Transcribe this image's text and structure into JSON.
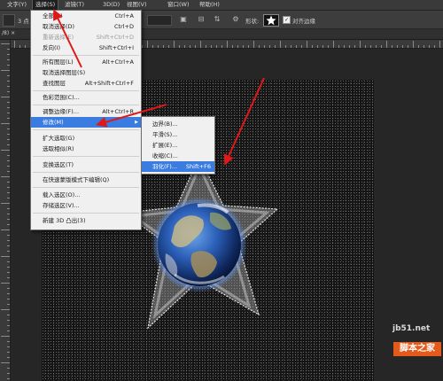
{
  "menubar": {
    "items": [
      "文字(Y)",
      "选择(S)",
      "滤镜(T)",
      "3D(D)",
      "视图(V)",
      "窗口(W)",
      "帮助(H)"
    ]
  },
  "options": {
    "size_value": "3 点",
    "shape_label": "形状:",
    "align_edges_label": "对齐边缘",
    "align_edges_checked": true
  },
  "document_tab": {
    "label": "/8) ×"
  },
  "select_menu": {
    "items": [
      {
        "label": "全部(A)",
        "shortcut": "Ctrl+A",
        "disabled": false
      },
      {
        "label": "取消选择(D)",
        "shortcut": "Ctrl+D",
        "disabled": false
      },
      {
        "label": "重新选择(E)",
        "shortcut": "Shift+Ctrl+D",
        "disabled": true
      },
      {
        "label": "反向(I)",
        "shortcut": "Shift+Ctrl+I",
        "disabled": false
      },
      {
        "label": "所有图层(L)",
        "shortcut": "Alt+Ctrl+A",
        "disabled": false
      },
      {
        "label": "取消选择图层(S)",
        "shortcut": "",
        "disabled": false
      },
      {
        "label": "查找图层",
        "shortcut": "Alt+Shift+Ctrl+F",
        "disabled": false
      },
      {
        "label": "色彩范围(C)...",
        "shortcut": "",
        "disabled": false
      },
      {
        "label": "调整边缘(F)...",
        "shortcut": "Alt+Ctrl+R",
        "disabled": false
      },
      {
        "label": "修改(M)",
        "shortcut": "",
        "disabled": false,
        "highlighted": true,
        "has_submenu": true
      },
      {
        "label": "扩大选取(G)",
        "shortcut": "",
        "disabled": false
      },
      {
        "label": "选取相似(R)",
        "shortcut": "",
        "disabled": false
      },
      {
        "label": "变换选区(T)",
        "shortcut": "",
        "disabled": false
      },
      {
        "label": "在快速蒙版模式下编辑(Q)",
        "shortcut": "",
        "disabled": false
      },
      {
        "label": "载入选区(O)...",
        "shortcut": "",
        "disabled": false
      },
      {
        "label": "存储选区(V)...",
        "shortcut": "",
        "disabled": false
      },
      {
        "label": "新建 3D 凸出(3)",
        "shortcut": "",
        "disabled": false
      }
    ]
  },
  "modify_submenu": {
    "items": [
      {
        "label": "边界(B)...",
        "shortcut": ""
      },
      {
        "label": "平滑(S)...",
        "shortcut": ""
      },
      {
        "label": "扩展(E)...",
        "shortcut": ""
      },
      {
        "label": "收缩(C)...",
        "shortcut": ""
      },
      {
        "label": "羽化(F)...",
        "shortcut": "Shift+F6",
        "highlighted": true
      }
    ]
  },
  "watermark": {
    "site": "jb51.net",
    "name": "脚本之家"
  },
  "colors": {
    "menu_highlight": "#3b7ce0",
    "annotation_arrow": "#e01818",
    "watermark_badge": "#e35a1a"
  }
}
